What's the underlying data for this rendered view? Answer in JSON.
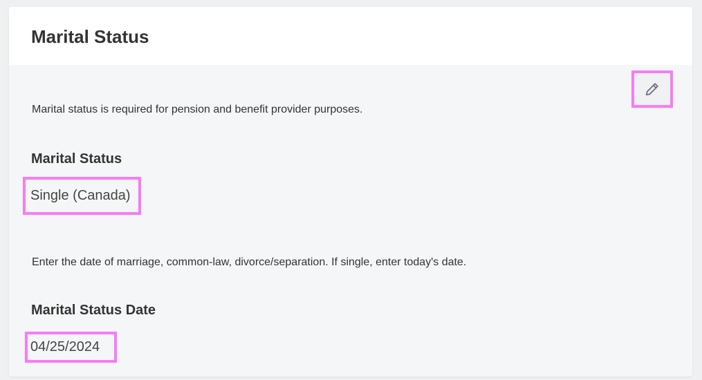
{
  "card": {
    "title": "Marital Status",
    "edit_icon": "pencil-icon",
    "help_text_status": "Marital status is required for pension and benefit provider purposes.",
    "status_label": "Marital Status",
    "status_value": "Single (Canada)",
    "help_text_date": "Enter the date of marriage, common-law, divorce/separation. If single, enter today's date.",
    "date_label": "Marital Status Date",
    "date_value": "04/25/2024"
  },
  "colors": {
    "page_background": "#eef0f2",
    "card_background": "#ffffff",
    "body_background": "#f5f6f8",
    "highlight": "#f77bf7",
    "text": "#333333",
    "icon": "#6b7280"
  }
}
